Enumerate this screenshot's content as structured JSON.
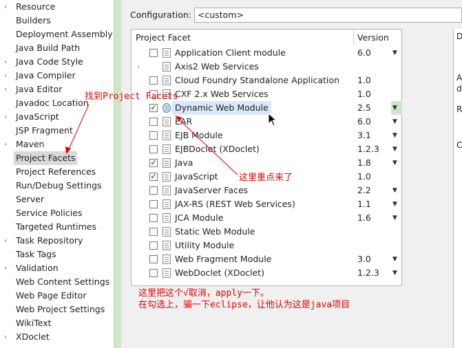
{
  "nav": {
    "items": [
      {
        "label": "Resource",
        "expandable": true
      },
      {
        "label": "Builders",
        "expandable": false
      },
      {
        "label": "Deployment Assembly",
        "expandable": false
      },
      {
        "label": "Java Build Path",
        "expandable": false
      },
      {
        "label": "Java Code Style",
        "expandable": true
      },
      {
        "label": "Java Compiler",
        "expandable": true
      },
      {
        "label": "Java Editor",
        "expandable": true
      },
      {
        "label": "Javadoc Location",
        "expandable": false
      },
      {
        "label": "JavaScript",
        "expandable": true
      },
      {
        "label": "JSP Fragment",
        "expandable": false
      },
      {
        "label": "Maven",
        "expandable": true
      },
      {
        "label": "Project Facets",
        "expandable": false,
        "selected": true
      },
      {
        "label": "Project References",
        "expandable": false
      },
      {
        "label": "Run/Debug Settings",
        "expandable": false
      },
      {
        "label": "Server",
        "expandable": false
      },
      {
        "label": "Service Policies",
        "expandable": false
      },
      {
        "label": "Targeted Runtimes",
        "expandable": false
      },
      {
        "label": "Task Repository",
        "expandable": true
      },
      {
        "label": "Task Tags",
        "expandable": false
      },
      {
        "label": "Validation",
        "expandable": true
      },
      {
        "label": "Web Content Settings",
        "expandable": false
      },
      {
        "label": "Web Page Editor",
        "expandable": false
      },
      {
        "label": "Web Project Settings",
        "expandable": false
      },
      {
        "label": "WikiText",
        "expandable": false
      },
      {
        "label": "XDoclet",
        "expandable": true
      }
    ]
  },
  "config": {
    "label": "Configuration:",
    "value": "<custom>"
  },
  "table": {
    "header_facet": "Project Facet",
    "header_version": "Version",
    "rows": [
      {
        "name": "Application Client module",
        "checked": false,
        "version": "6.0",
        "dropdown": true,
        "icon": "doc"
      },
      {
        "name": "Axis2 Web Services",
        "checked": null,
        "version": "",
        "dropdown": false,
        "icon": "doc",
        "expandable": true
      },
      {
        "name": "Cloud Foundry Standalone Application",
        "checked": false,
        "version": "1.0",
        "dropdown": false,
        "icon": "doc"
      },
      {
        "name": "CXF 2.x Web Services",
        "checked": false,
        "version": "1.0",
        "dropdown": false,
        "icon": "doc"
      },
      {
        "name": "Dynamic Web Module",
        "checked": true,
        "version": "2.5",
        "dropdown": true,
        "icon": "web",
        "highlight": true
      },
      {
        "name": "EAR",
        "checked": false,
        "version": "6.0",
        "dropdown": true,
        "icon": "doc"
      },
      {
        "name": "EJB Module",
        "checked": false,
        "version": "3.1",
        "dropdown": true,
        "icon": "doc"
      },
      {
        "name": "EJBDoclet (XDoclet)",
        "checked": false,
        "version": "1.2.3",
        "dropdown": true,
        "icon": "doc"
      },
      {
        "name": "Java",
        "checked": true,
        "version": "1.8",
        "dropdown": true,
        "icon": "java"
      },
      {
        "name": "JavaScript",
        "checked": true,
        "version": "1.0",
        "dropdown": false,
        "icon": "doc"
      },
      {
        "name": "JavaServer Faces",
        "checked": false,
        "version": "2.2",
        "dropdown": true,
        "icon": "doc"
      },
      {
        "name": "JAX-RS (REST Web Services)",
        "checked": false,
        "version": "1.1",
        "dropdown": true,
        "icon": "doc"
      },
      {
        "name": "JCA Module",
        "checked": false,
        "version": "1.6",
        "dropdown": true,
        "icon": "doc"
      },
      {
        "name": "Static Web Module",
        "checked": false,
        "version": "",
        "dropdown": false,
        "icon": "doc"
      },
      {
        "name": "Utility Module",
        "checked": false,
        "version": "",
        "dropdown": false,
        "icon": "doc"
      },
      {
        "name": "Web Fragment Module",
        "checked": false,
        "version": "3.0",
        "dropdown": true,
        "icon": "doc"
      },
      {
        "name": "WebDoclet (XDoclet)",
        "checked": false,
        "version": "1.2.3",
        "dropdown": true,
        "icon": "doc"
      }
    ]
  },
  "edge_letters": [
    "D",
    "A",
    "dy",
    "R",
    "C"
  ],
  "annotations": {
    "find_facets": "找到Project Facets",
    "key_point": "这里重点来了",
    "line1": "这里把这个√取消，apply一下。",
    "line2": "在勾选上，骗一下eclipse，让他认为这是java项目"
  },
  "colors": {
    "annotation": "#e00000",
    "highlight": "#d9e8fb",
    "gutter": "#cfe7c8"
  }
}
